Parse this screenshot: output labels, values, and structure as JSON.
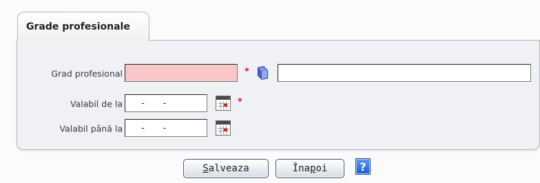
{
  "tab": {
    "label": "Grade profesionale"
  },
  "form": {
    "grad_profesional": {
      "label": "Grad profesional",
      "value": "",
      "required": true,
      "description_value": ""
    },
    "valabil_de_la": {
      "label": "Valabil de la",
      "value": "  -   -",
      "required": true
    },
    "valabil_pana_la": {
      "label": "Valabil până la",
      "value": "  -   -",
      "required": false
    },
    "required_marker": "*"
  },
  "buttons": {
    "save": {
      "underlined": "S",
      "rest": "alveaza"
    },
    "back": {
      "before": "Îna",
      "underlined": "p",
      "after": "oi"
    },
    "help": "?"
  },
  "colors": {
    "required_empty_bg": "#f9c7c7",
    "required_star": "#d02020",
    "help_blue": "#1d5bd8"
  },
  "icons": [
    "lookup-book-icon",
    "calendar-icon",
    "help-icon"
  ]
}
